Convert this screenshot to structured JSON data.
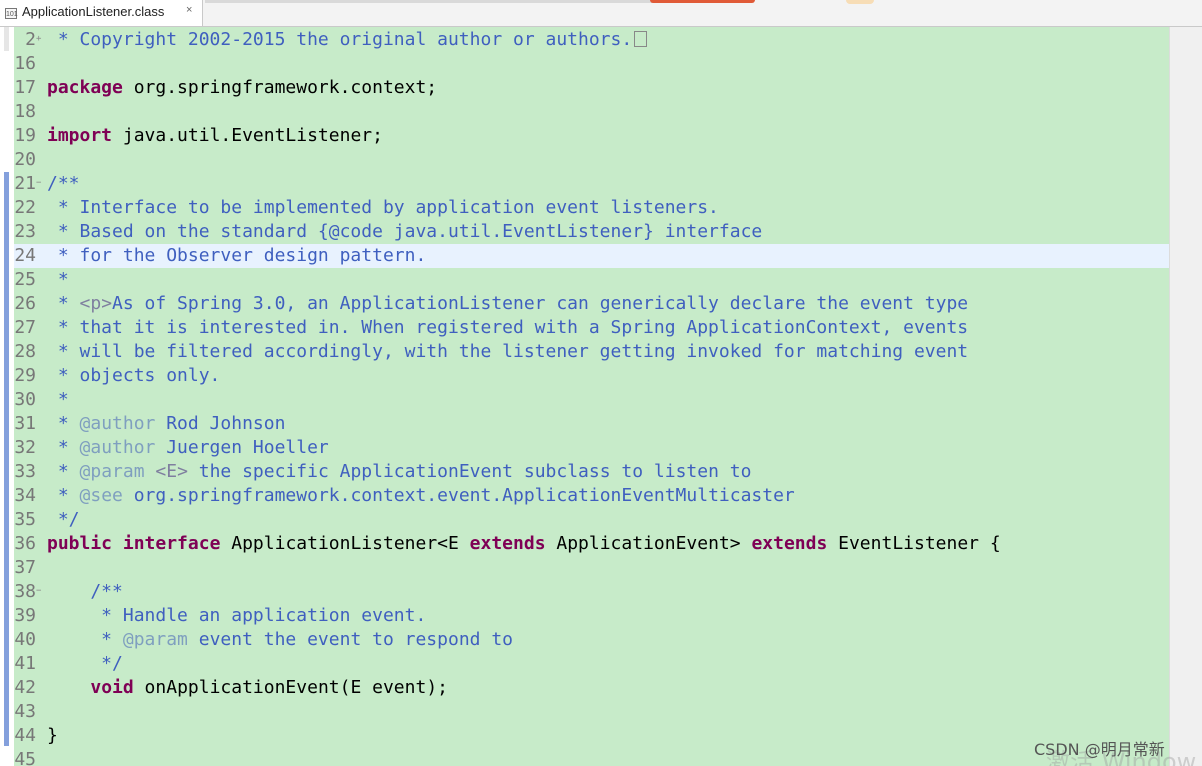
{
  "tab": {
    "label": "ApplicationListener.class",
    "icon": "class-file-icon",
    "close": "×"
  },
  "lines": [
    {
      "n": "2",
      "fold": "+",
      "tokens": [
        {
          "t": " * Copyright 2002-2015 the original author or authors.",
          "c": "jd"
        }
      ],
      "folded": true
    },
    {
      "n": "16",
      "tokens": []
    },
    {
      "n": "17",
      "tokens": [
        {
          "t": "package",
          "c": "kw"
        },
        {
          "t": " org.springframework.context;",
          "c": "pl"
        }
      ]
    },
    {
      "n": "18",
      "tokens": []
    },
    {
      "n": "19",
      "tokens": [
        {
          "t": "import",
          "c": "kw"
        },
        {
          "t": " java.util.EventListener;",
          "c": "pl"
        }
      ]
    },
    {
      "n": "20",
      "tokens": []
    },
    {
      "n": "21",
      "fold": "−",
      "tokens": [
        {
          "t": "/**",
          "c": "jd"
        }
      ]
    },
    {
      "n": "22",
      "tokens": [
        {
          "t": " * Interface to be implemented by application event listeners.",
          "c": "jd"
        }
      ]
    },
    {
      "n": "23",
      "tokens": [
        {
          "t": " * Based on the standard {@code java.util.EventListener} interface",
          "c": "jd"
        }
      ]
    },
    {
      "n": "24",
      "current": true,
      "tokens": [
        {
          "t": " * for the Observer design pattern.",
          "c": "jd"
        }
      ]
    },
    {
      "n": "25",
      "tokens": [
        {
          "t": " *",
          "c": "jd"
        }
      ]
    },
    {
      "n": "26",
      "tokens": [
        {
          "t": " * ",
          "c": "jd"
        },
        {
          "t": "<p>",
          "c": "ht"
        },
        {
          "t": "As of Spring 3.0, an ApplicationListener can generically declare the event type",
          "c": "jd"
        }
      ]
    },
    {
      "n": "27",
      "tokens": [
        {
          "t": " * that it is interested in. When registered with a Spring ApplicationContext, events",
          "c": "jd"
        }
      ]
    },
    {
      "n": "28",
      "tokens": [
        {
          "t": " * will be filtered accordingly, with the listener getting invoked for matching event",
          "c": "jd"
        }
      ]
    },
    {
      "n": "29",
      "tokens": [
        {
          "t": " * objects only.",
          "c": "jd"
        }
      ]
    },
    {
      "n": "30",
      "tokens": [
        {
          "t": " *",
          "c": "jd"
        }
      ]
    },
    {
      "n": "31",
      "tokens": [
        {
          "t": " * ",
          "c": "jd"
        },
        {
          "t": "@author",
          "c": "tg"
        },
        {
          "t": " Rod Johnson",
          "c": "jd"
        }
      ]
    },
    {
      "n": "32",
      "tokens": [
        {
          "t": " * ",
          "c": "jd"
        },
        {
          "t": "@author",
          "c": "tg"
        },
        {
          "t": " Juergen Hoeller",
          "c": "jd"
        }
      ]
    },
    {
      "n": "33",
      "tokens": [
        {
          "t": " * ",
          "c": "jd"
        },
        {
          "t": "@param",
          "c": "tg"
        },
        {
          "t": " ",
          "c": "jd"
        },
        {
          "t": "<E>",
          "c": "ht"
        },
        {
          "t": " the specific ApplicationEvent subclass to listen to",
          "c": "jd"
        }
      ]
    },
    {
      "n": "34",
      "tokens": [
        {
          "t": " * ",
          "c": "jd"
        },
        {
          "t": "@see",
          "c": "tg"
        },
        {
          "t": " org.springframework.context.event.ApplicationEventMulticaster",
          "c": "jd"
        }
      ]
    },
    {
      "n": "35",
      "tokens": [
        {
          "t": " */",
          "c": "jd"
        }
      ]
    },
    {
      "n": "36",
      "tokens": [
        {
          "t": "public",
          "c": "kw"
        },
        {
          "t": " ",
          "c": "pl"
        },
        {
          "t": "interface",
          "c": "kw"
        },
        {
          "t": " ApplicationListener<E ",
          "c": "pl"
        },
        {
          "t": "extends",
          "c": "kw"
        },
        {
          "t": " ApplicationEvent> ",
          "c": "pl"
        },
        {
          "t": "extends",
          "c": "kw"
        },
        {
          "t": " EventListener {",
          "c": "pl"
        }
      ]
    },
    {
      "n": "37",
      "tokens": []
    },
    {
      "n": "38",
      "fold": "−",
      "tokens": [
        {
          "t": "    /**",
          "c": "jd"
        }
      ]
    },
    {
      "n": "39",
      "tokens": [
        {
          "t": "     * Handle an application event.",
          "c": "jd"
        }
      ]
    },
    {
      "n": "40",
      "tokens": [
        {
          "t": "     * ",
          "c": "jd"
        },
        {
          "t": "@param",
          "c": "tg"
        },
        {
          "t": " event the event to respond to",
          "c": "jd"
        }
      ]
    },
    {
      "n": "41",
      "tokens": [
        {
          "t": "     */",
          "c": "jd"
        }
      ]
    },
    {
      "n": "42",
      "tokens": [
        {
          "t": "    ",
          "c": "pl"
        },
        {
          "t": "void",
          "c": "kw"
        },
        {
          "t": " onApplicationEvent(E event);",
          "c": "pl"
        }
      ]
    },
    {
      "n": "43",
      "tokens": []
    },
    {
      "n": "44",
      "tokens": [
        {
          "t": "}",
          "c": "pl"
        }
      ]
    },
    {
      "n": "45",
      "tokens": []
    }
  ],
  "watermark": "CSDN @明月常新",
  "watermark_ghost": "激活 Window"
}
